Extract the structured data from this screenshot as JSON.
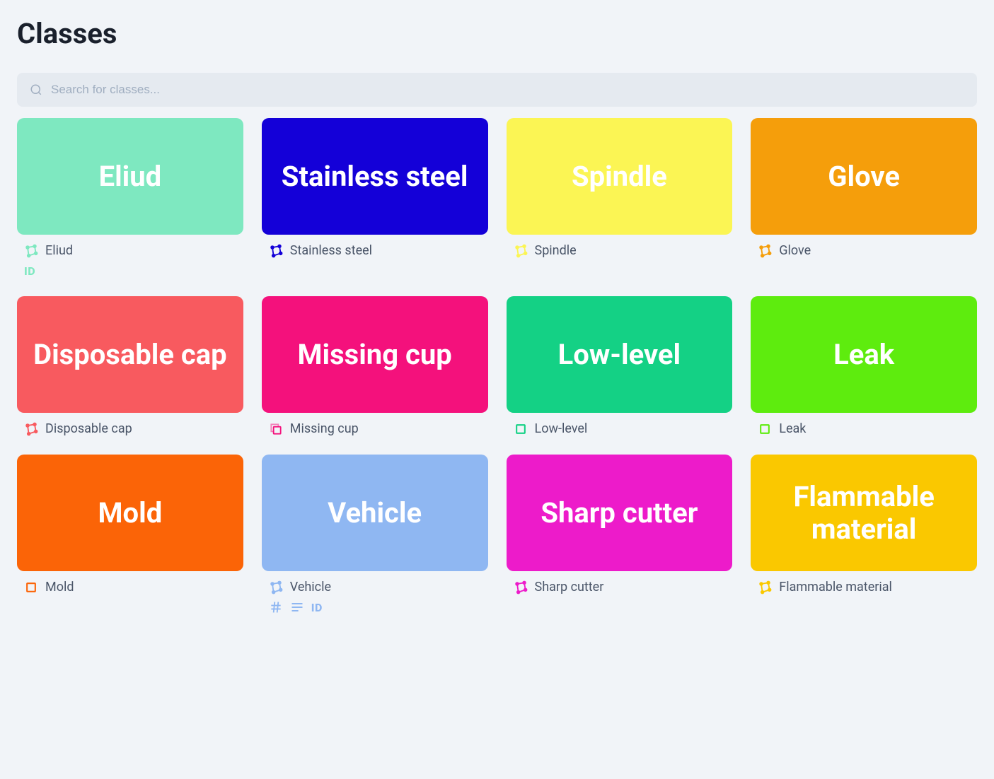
{
  "page": {
    "title": "Classes"
  },
  "search": {
    "placeholder": "Search for classes..."
  },
  "classes": [
    {
      "name": "Eliud",
      "color": "#7ee8c0",
      "icon": "polygon",
      "badges": [
        "id"
      ]
    },
    {
      "name": "Stainless steel",
      "color": "#1400d8",
      "icon": "polygon",
      "badges": []
    },
    {
      "name": "Spindle",
      "color": "#fbf554",
      "icon": "polygon",
      "badges": []
    },
    {
      "name": "Glove",
      "color": "#f59e0b",
      "icon": "polygon",
      "badges": []
    },
    {
      "name": "Disposable cap",
      "color": "#f85a5f",
      "icon": "polygon",
      "badges": []
    },
    {
      "name": "Missing cup",
      "color": "#f4117c",
      "icon": "copy",
      "badges": []
    },
    {
      "name": "Low-level",
      "color": "#14d185",
      "icon": "box",
      "badges": []
    },
    {
      "name": "Leak",
      "color": "#5eec0e",
      "icon": "box",
      "badges": []
    },
    {
      "name": "Mold",
      "color": "#fb6407",
      "icon": "box",
      "badges": []
    },
    {
      "name": "Vehicle",
      "color": "#8fb7f2",
      "icon": "polygon",
      "badges": [
        "hash",
        "lines",
        "id"
      ]
    },
    {
      "name": "Sharp cutter",
      "color": "#ed1bca",
      "icon": "polygon",
      "badges": []
    },
    {
      "name": "Flammable material",
      "color": "#fac800",
      "icon": "polygon",
      "badges": []
    }
  ]
}
